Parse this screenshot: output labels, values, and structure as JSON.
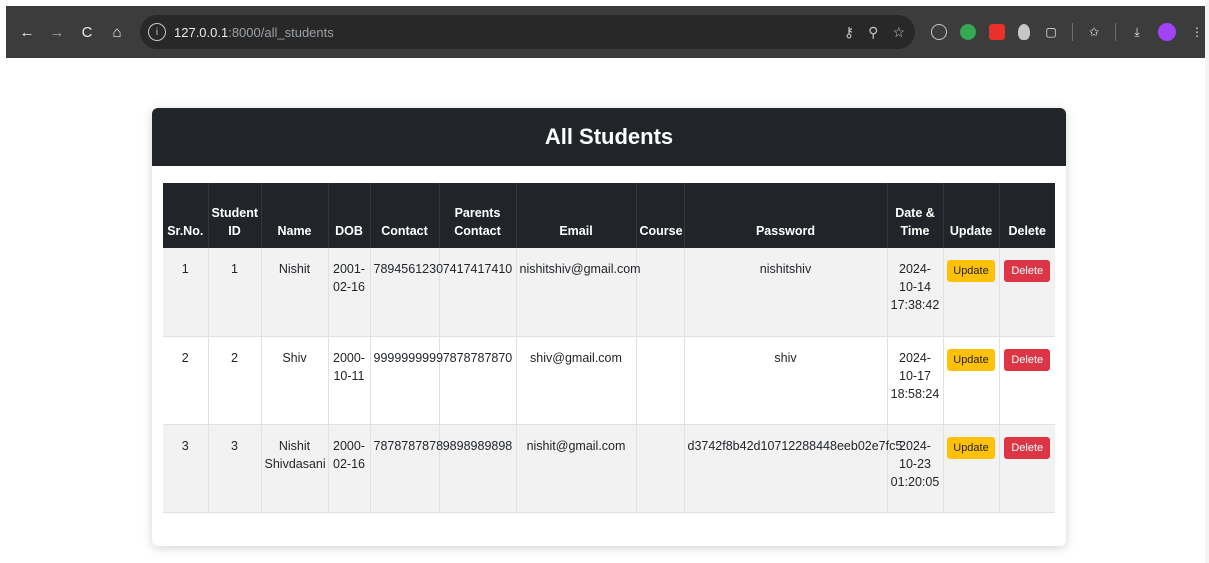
{
  "browser": {
    "url_host": "127.0.0.1",
    "url_path": ":8000/all_students",
    "back_icon": "←",
    "forward_icon": "→",
    "reload_icon": "C",
    "home_icon": "⌂"
  },
  "page": {
    "title": "All Students"
  },
  "table": {
    "headers": {
      "srno": "Sr.No.",
      "student_id_1": "Student",
      "student_id_2": "ID",
      "name": "Name",
      "dob": "DOB",
      "contact": "Contact",
      "parents_contact_1": "Parents",
      "parents_contact_2": "Contact",
      "email": "Email",
      "course": "Course",
      "password": "Password",
      "datetime_1": "Date &",
      "datetime_2": "Time",
      "update": "Update",
      "delete": "Delete"
    },
    "rows": [
      {
        "srno": "1",
        "student_id": "1",
        "name_1": "Nishit",
        "name_2": "",
        "dob_1": "2001-",
        "dob_2": "02-16",
        "contact": "7894561230",
        "parents_contact": "7417417410",
        "email": "nishitshiv@gmail.com",
        "course": "",
        "password": "nishitshiv",
        "dt_1": "2024-",
        "dt_2": "10-14",
        "dt_3": "17:38:42",
        "update_label": "Update",
        "delete_label": "Delete"
      },
      {
        "srno": "2",
        "student_id": "2",
        "name_1": "Shiv",
        "name_2": "",
        "dob_1": "2000-",
        "dob_2": "10-11",
        "contact": "9999999999",
        "parents_contact": "7878787870",
        "email": "shiv@gmail.com",
        "course": "",
        "password": "shiv",
        "dt_1": "2024-",
        "dt_2": "10-17",
        "dt_3": "18:58:24",
        "update_label": "Update",
        "delete_label": "Delete"
      },
      {
        "srno": "3",
        "student_id": "3",
        "name_1": "Nishit",
        "name_2": "Shivdasani",
        "dob_1": "2000-",
        "dob_2": "02-16",
        "contact": "7878787878",
        "parents_contact": "9898989898",
        "email": "nishit@gmail.com",
        "course": "",
        "password": "d3742f8b42d10712288448eeb02e7fc5",
        "dt_1": "2024-",
        "dt_2": "10-23",
        "dt_3": "01:20:05",
        "update_label": "Update",
        "delete_label": "Delete"
      }
    ]
  },
  "colors": {
    "header_dark": "#212529",
    "update_btn": "#ffc107",
    "delete_btn": "#dc3545",
    "stripe": "#f2f2f2"
  }
}
